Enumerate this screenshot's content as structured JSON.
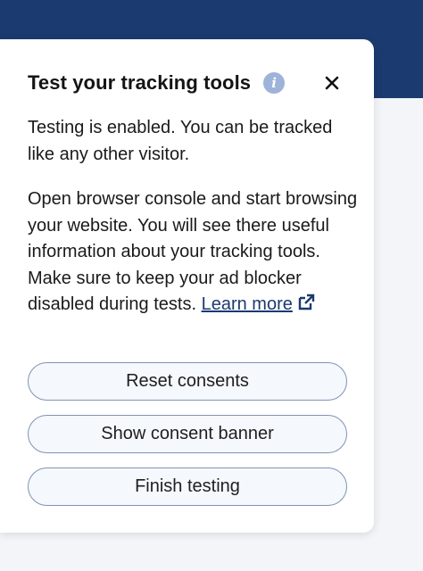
{
  "panel": {
    "title": "Test your tracking tools",
    "info_icon": "info-icon",
    "close_icon": "close-icon",
    "paragraph_1": "Testing is enabled. You can be tracked like any other visitor.",
    "paragraph_2": "Open browser console and start browsing your website. You will see there useful information about your tracking tools. Make sure to keep your ad blocker disabled during tests.",
    "learn_more_label": "Learn more",
    "external_link_icon": "external-link-icon",
    "buttons": {
      "reset": "Reset consents",
      "show_banner": "Show consent banner",
      "finish": "Finish testing"
    }
  },
  "colors": {
    "header_bg": "#1b3a70",
    "accent": "#1b3a70",
    "info_icon_bg": "#9eb3d8",
    "button_border": "#7f93b5",
    "button_bg": "#f5f8fc"
  }
}
